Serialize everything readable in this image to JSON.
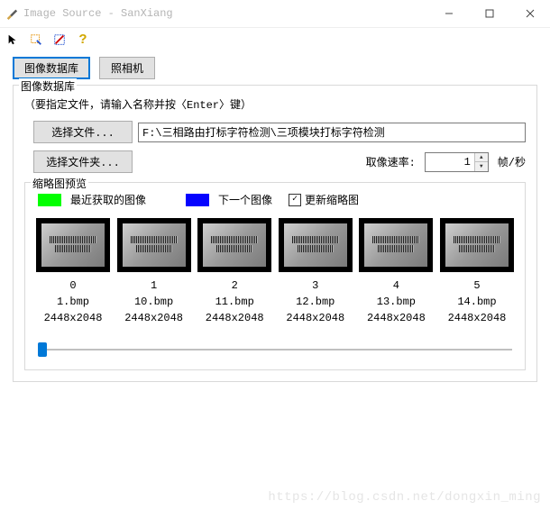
{
  "titlebar": {
    "title": "Image Source - SanXiang"
  },
  "tabs": {
    "image_db": "图像数据库",
    "camera": "照相机"
  },
  "fieldset_title": "图像数据库",
  "hint": "（要指定文件，请输入名称并按〈Enter〉键）",
  "buttons": {
    "choose_file": "选择文件...",
    "choose_folder": "选择文件夹..."
  },
  "path_value": "F:\\三相路由打标字符检测\\三项模块打标字符检测",
  "rate": {
    "label": "取像速率:",
    "value": "1",
    "unit": "帧/秒"
  },
  "preview": {
    "title": "缩略图预览",
    "legend_recent": "最近获取的图像",
    "legend_next": "下一个图像",
    "checkbox_update": "更新缩略图",
    "checkbox_checked": true
  },
  "thumbs": [
    {
      "idx": "0",
      "fname": "1.bmp",
      "dims": "2448x2048"
    },
    {
      "idx": "1",
      "fname": "10.bmp",
      "dims": "2448x2048"
    },
    {
      "idx": "2",
      "fname": "11.bmp",
      "dims": "2448x2048"
    },
    {
      "idx": "3",
      "fname": "12.bmp",
      "dims": "2448x2048"
    },
    {
      "idx": "4",
      "fname": "13.bmp",
      "dims": "2448x2048"
    },
    {
      "idx": "5",
      "fname": "14.bmp",
      "dims": "2448x2048"
    }
  ],
  "colors": {
    "recent": "#01ff00",
    "next": "#0503ff",
    "accent": "#0078d7"
  },
  "watermark": "https://blog.csdn.net/dongxin_ming"
}
